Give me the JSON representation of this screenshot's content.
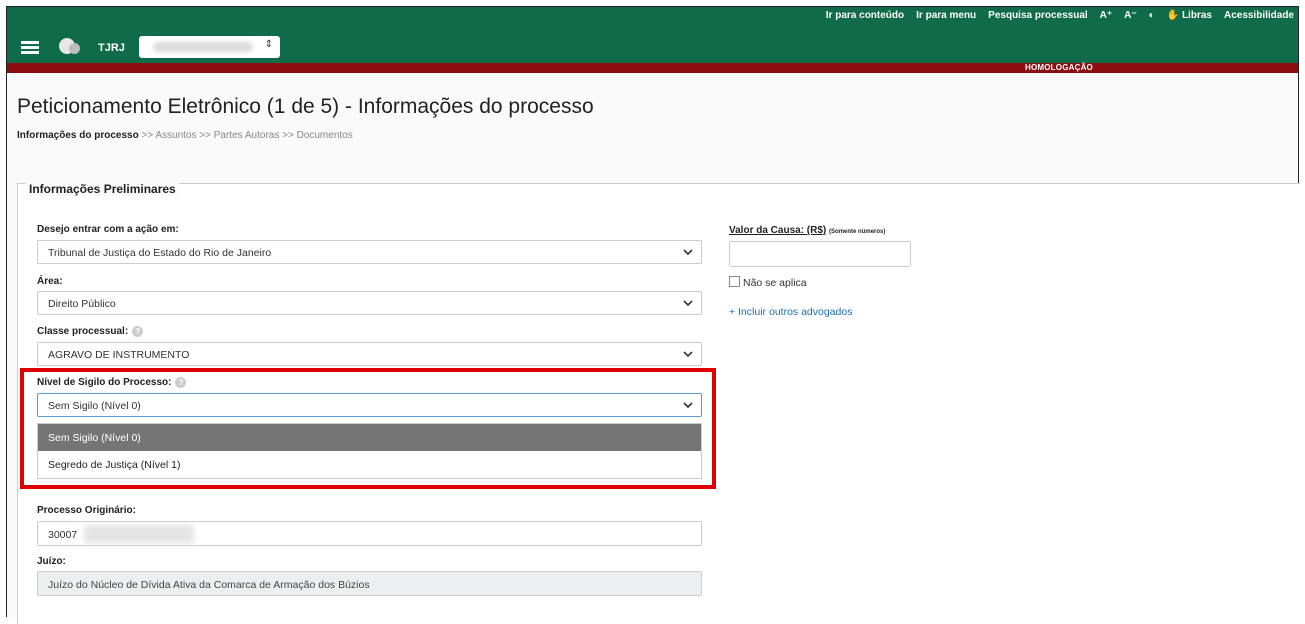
{
  "header": {
    "top_links": [
      "Ir para conteúdo",
      "Ir para menu",
      "Pesquisa processual",
      "A⁺",
      "A⁻",
      "◐",
      "✋ Libras",
      "Acessibilidade"
    ],
    "brand": "TJRJ",
    "unit_select_arrow": "⇕",
    "env_label": "HOMOLOGAÇÃO"
  },
  "page": {
    "title": "Peticionamento Eletrônico (1 de 5) - Informações do processo",
    "breadcrumb": {
      "current": "Informações do processo",
      "rest": " >> Assuntos >> Partes Autoras >> Documentos"
    }
  },
  "form": {
    "legend": "Informações Preliminares",
    "acao_label": "Desejo entrar com a ação em:",
    "acao_value": "Tribunal de Justiça do Estado do Rio de Janeiro",
    "area_label": "Área:",
    "area_value": "Direito Público",
    "classe_label": "Classe processual:",
    "classe_value": "AGRAVO DE INSTRUMENTO",
    "sigilo_label": "Nível de Sigilo do Processo:",
    "sigilo_value": "Sem Sigilo (Nível 0)",
    "sigilo_options": [
      "Sem Sigilo (Nível 0)",
      "Segredo de Justiça (Nível 1)"
    ],
    "originario_label": "Processo Originário:",
    "originario_value": "30007",
    "juizo_label": "Juízo:",
    "juizo_value": "Juízo do Núcleo de Dívida Ativa da Comarca de Armação dos Búzios",
    "valor_label": "Valor da Causa: (R$)",
    "valor_hint": "(Somente números)",
    "valor_value": "",
    "nao_aplica_label": "Não se aplica",
    "incluir_link": "+ Incluir outros advogados"
  },
  "colors": {
    "header_green": "#0f6b4a",
    "env_red": "#8d0e12",
    "highlight_red": "#e00000",
    "selected_option": "#757575",
    "link_blue": "#1f6fb7"
  }
}
